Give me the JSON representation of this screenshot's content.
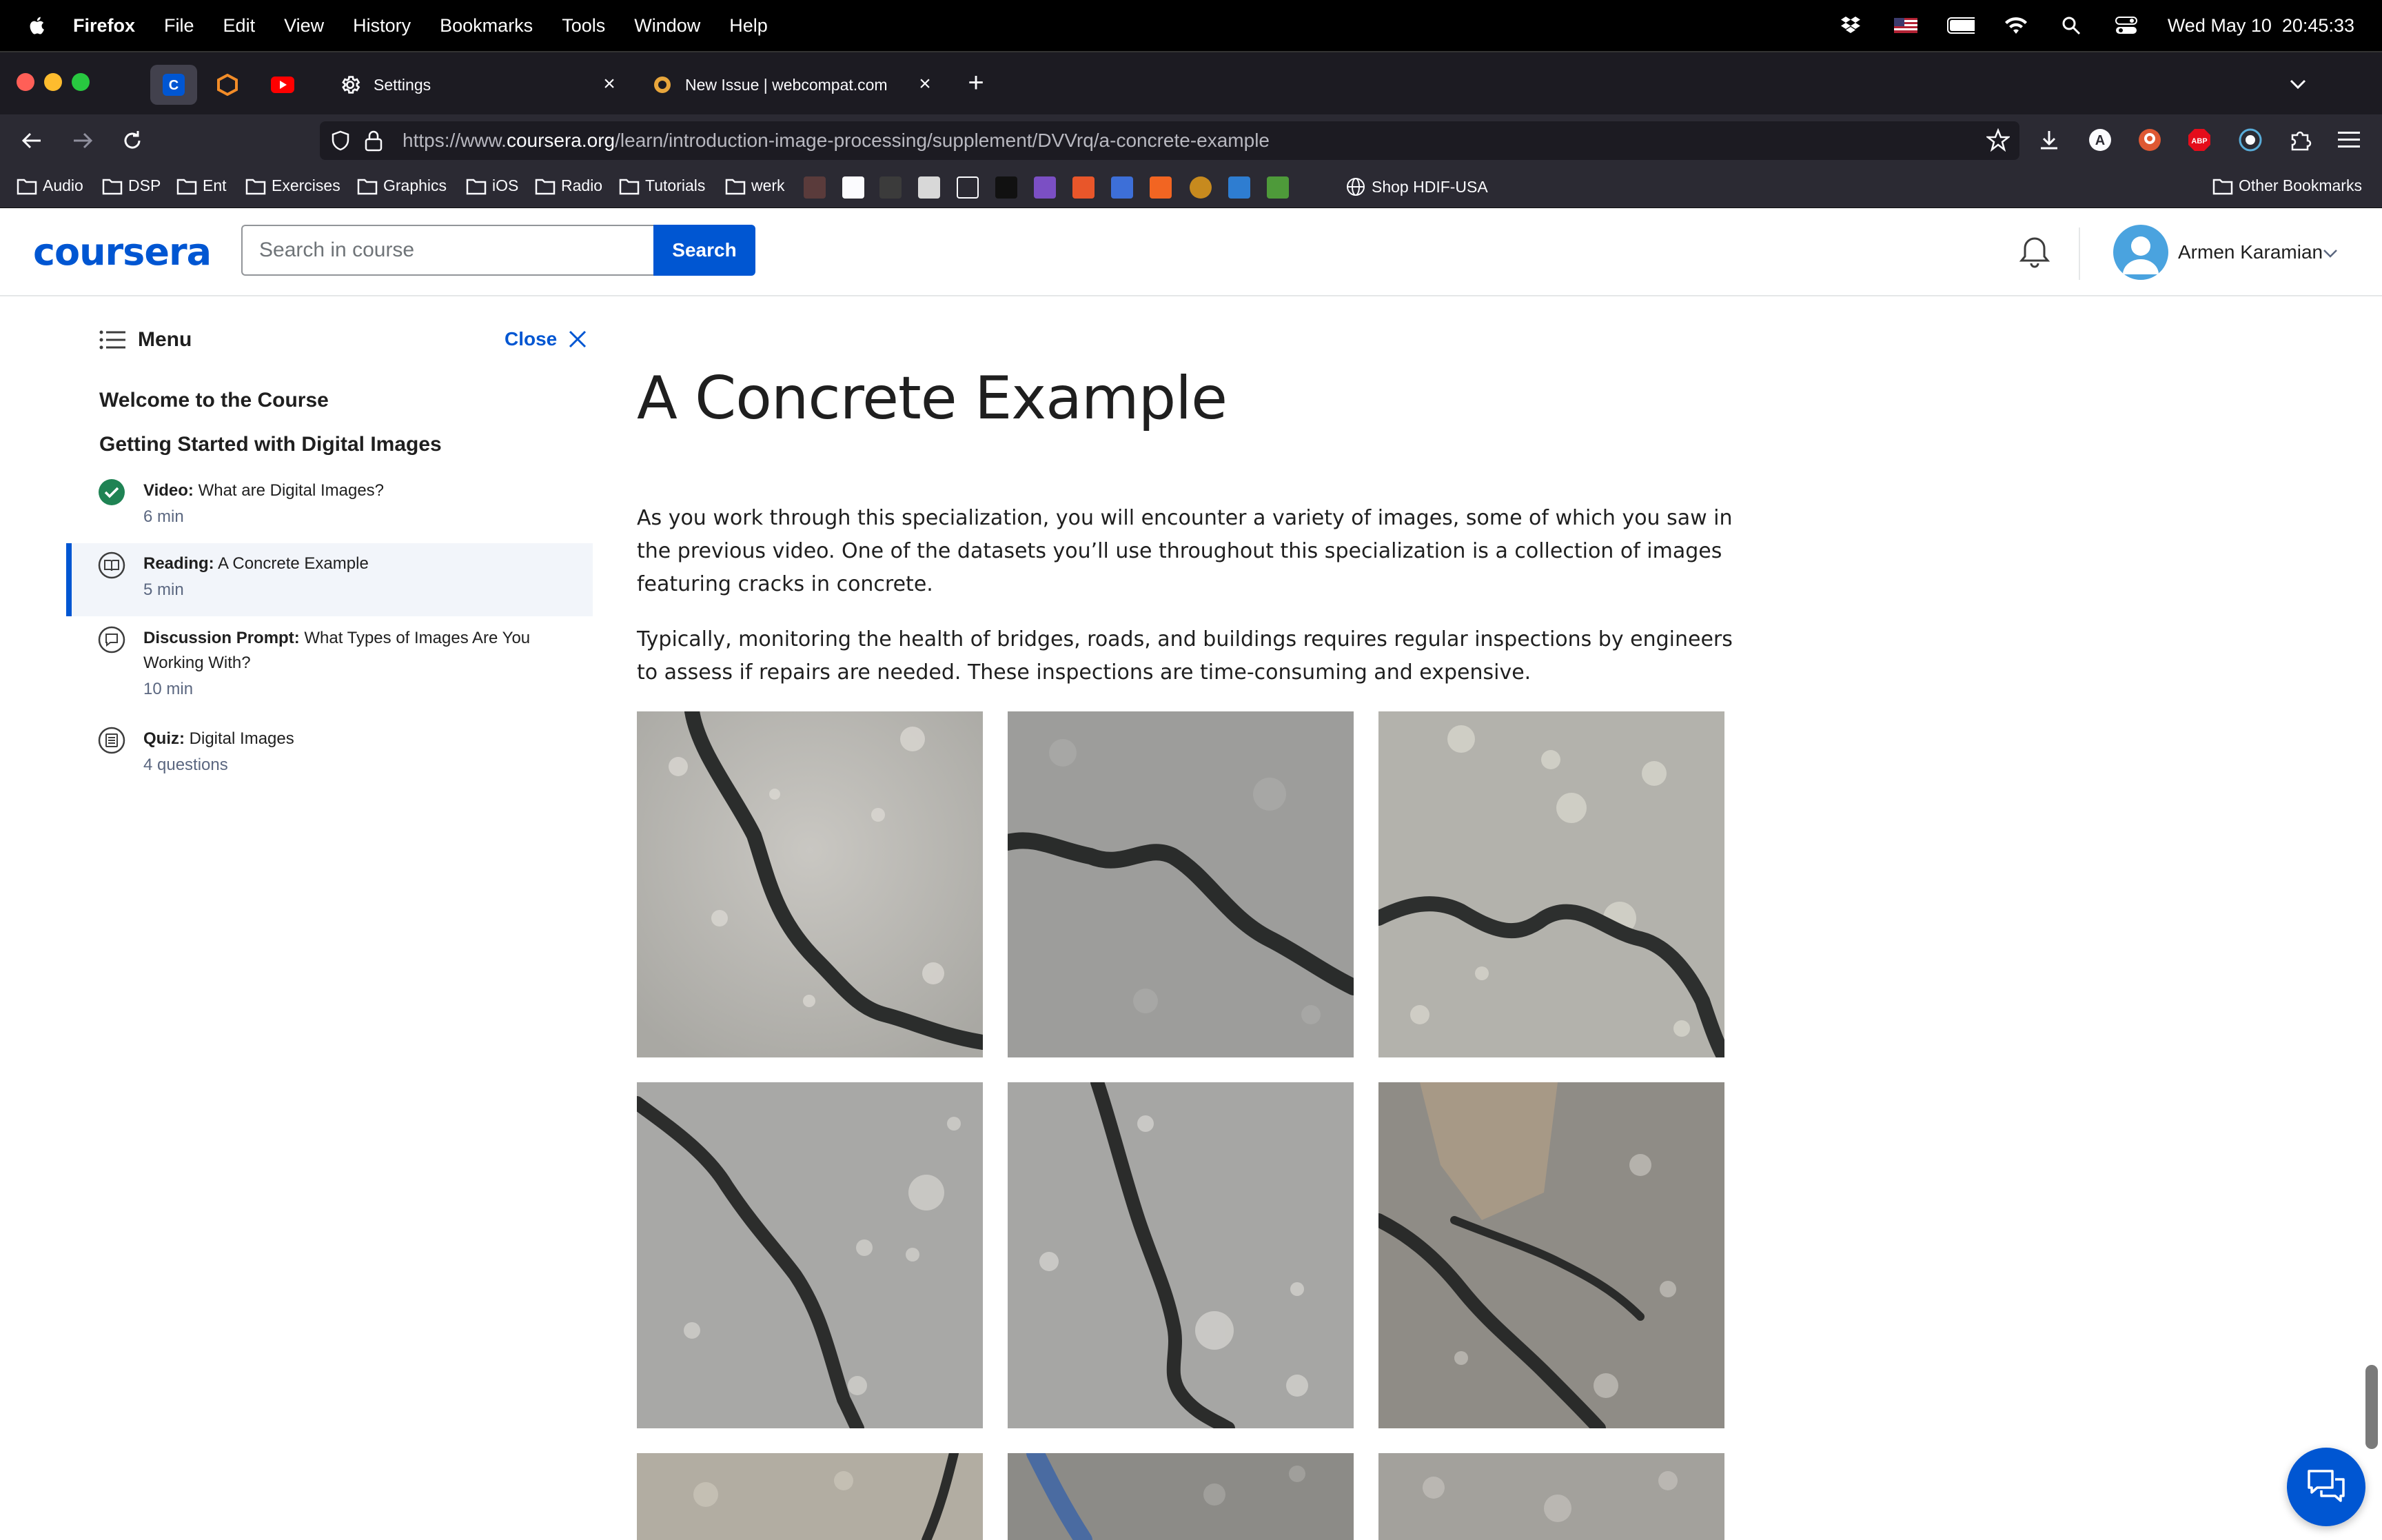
{
  "menubar": {
    "app_name": "Firefox",
    "menus": [
      "File",
      "Edit",
      "View",
      "History",
      "Bookmarks",
      "Tools",
      "Window",
      "Help"
    ],
    "clock": "Wed May 10  20:45:33"
  },
  "tabs": {
    "settings_label": "Settings",
    "webcompat_label": "New Issue | webcompat.com"
  },
  "navbar": {
    "url_prefix": "https://www.",
    "url_domain": "coursera.org",
    "url_path": "/learn/introduction-image-processing/supplement/DVVrq/a-concrete-example"
  },
  "bookmarks": {
    "folders": [
      "Audio",
      "DSP",
      "Ent",
      "Exercises",
      "Graphics",
      "iOS",
      "Radio",
      "Tutorials",
      "werk"
    ],
    "shop": "Shop HDIF-USA",
    "other": "Other Bookmarks"
  },
  "header": {
    "logo": "coursera",
    "search_placeholder": "Search in course",
    "search_button": "Search",
    "user_name": "Armen Karamian"
  },
  "sidebar": {
    "menu_label": "Menu",
    "close_label": "Close",
    "section_1": "Welcome to the Course",
    "section_2": "Getting Started with Digital Images",
    "items": [
      {
        "type": "Video:",
        "title": " What are Digital Images?",
        "meta": "6 min",
        "icon": "check-circle-icon"
      },
      {
        "type": "Reading:",
        "title": " A Concrete Example",
        "meta": "5 min",
        "icon": "book-icon"
      },
      {
        "type": "Discussion Prompt:",
        "title": " What Types of Images Are You Working With?",
        "meta": "10 min",
        "icon": "chat-bubble-icon"
      },
      {
        "type": "Quiz:",
        "title": " Digital Images",
        "meta": "4 questions",
        "icon": "quiz-list-icon"
      }
    ]
  },
  "main": {
    "title": "A Concrete Example",
    "paragraph_1": "As you work through this specialization, you will encounter a variety of images, some of which you saw in the previous video. One of the datasets you’ll use throughout this specialization is a collection of images featuring cracks in concrete.",
    "paragraph_2": "Typically, monitoring the health of bridges, roads, and buildings requires regular inspections by engineers to assess if repairs are needed. These inspections are time-consuming and expensive."
  },
  "colors": {
    "coursera_blue": "#0056d2",
    "active_item_bg": "#f2f5fa",
    "completed_green": "#1f8354"
  }
}
